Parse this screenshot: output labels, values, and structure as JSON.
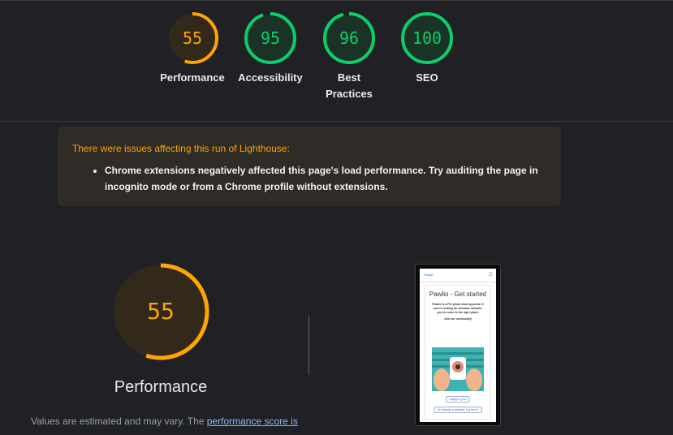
{
  "scores": [
    {
      "value": "55",
      "score": 55,
      "label": "Performance",
      "status": "average"
    },
    {
      "value": "95",
      "score": 95,
      "label": "Accessibility",
      "status": "pass"
    },
    {
      "value": "96",
      "score": 96,
      "label": "Best Practices",
      "status": "pass"
    },
    {
      "value": "100",
      "score": 100,
      "label": "SEO",
      "status": "pass"
    }
  ],
  "colors": {
    "average": "#ffa400",
    "average_fill": "#33291a",
    "pass": "#0cce6b",
    "pass_fill": "#1a3326",
    "link": "#8ab4f8"
  },
  "warning": {
    "title": "There were issues affecting this run of Lighthouse:",
    "items": [
      "Chrome extensions negatively affected this page's load performance. Try auditing the page in incognito mode or from a Chrome profile without extensions."
    ]
  },
  "performance": {
    "score": "55",
    "score_value": 55,
    "label": "Performance",
    "note_prefix": "Values are estimated and may vary. The ",
    "note_link": "performance score is"
  },
  "screenshot": {
    "logo": "Pawlio",
    "heading": "Pawlio - Get started",
    "body": "Pawlio is a Pet photo sharing portal. If you're looking for adorable animals, you've come to the right place!",
    "join": "Join our community!",
    "button1": "Happy to join!",
    "button2": "I'm already a member, log me in!"
  }
}
